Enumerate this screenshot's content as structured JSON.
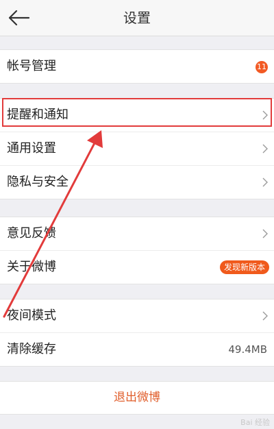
{
  "header": {
    "title": "设置",
    "back_icon": "back-arrow-icon"
  },
  "groups": [
    {
      "items": [
        {
          "label": "帐号管理",
          "badge": "11"
        }
      ]
    },
    {
      "items": [
        {
          "label": "提醒和通知"
        },
        {
          "label": "通用设置"
        },
        {
          "label": "隐私与安全"
        }
      ]
    },
    {
      "items": [
        {
          "label": "意见反馈"
        },
        {
          "label": "关于微博",
          "badge": "发现新版本"
        }
      ]
    },
    {
      "items": [
        {
          "label": "夜间模式"
        },
        {
          "label": "清除缓存",
          "value": "49.4MB"
        }
      ]
    }
  ],
  "logout": "退出微博",
  "watermark": "Bai 经验",
  "colors": {
    "accent": "#f05a1c",
    "annotation": "#e23b3b"
  }
}
